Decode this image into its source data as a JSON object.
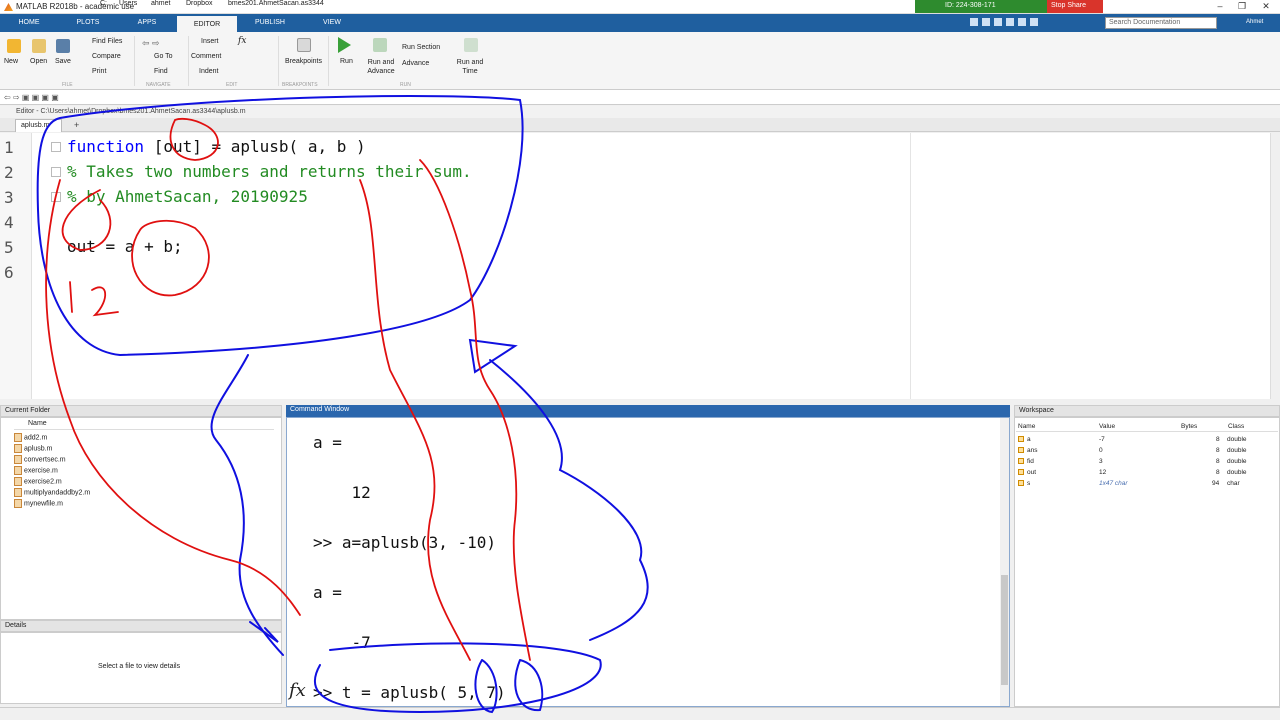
{
  "window": {
    "title": "MATLAB R2018b - academic use"
  },
  "share": {
    "id": "ID: 224-308-171",
    "stop": "Stop Share"
  },
  "tabs": [
    "HOME",
    "PLOTS",
    "APPS",
    "EDITOR",
    "PUBLISH",
    "VIEW"
  ],
  "search": {
    "placeholder": "Search Documentation"
  },
  "user": "Ahmet",
  "ribbon": {
    "file": {
      "new": "New",
      "open": "Open",
      "save": "Save",
      "find_files": "Find Files",
      "compare": "Compare",
      "print": "Print",
      "section": "FILE"
    },
    "navigate": {
      "go_to": "Go To",
      "find": "Find",
      "section": "NAVIGATE"
    },
    "edit": {
      "insert": "Insert",
      "comment": "Comment",
      "indent": "Indent",
      "section": "EDIT"
    },
    "breakpoints": {
      "label": "Breakpoints",
      "section": "BREAKPOINTS"
    },
    "run": {
      "run": "Run",
      "run_advance": "Run and Advance",
      "run_section": "Run Section",
      "advance": "Advance",
      "run_time": "Run and Time",
      "section": "RUN"
    }
  },
  "path": [
    "C:",
    "Users",
    "ahmet",
    "Dropbox",
    "bmes201.AhmetSacan.as3344"
  ],
  "editor": {
    "header": "Editor - C:\\Users\\ahmet\\Dropbox\\bmes201.AhmetSacan.as3344\\aplusb.m",
    "tab": "aplusb.m",
    "lines": [
      {
        "n": "1",
        "kw": "function",
        "rest": " [out] = aplusb( a, b )"
      },
      {
        "n": "2",
        "comment": "% Takes two numbers and returns their sum."
      },
      {
        "n": "3",
        "comment": "% by AhmetSacan, 20190925"
      },
      {
        "n": "4",
        "text": ""
      },
      {
        "n": "5",
        "text": "out = a + b;"
      },
      {
        "n": "6",
        "text": ""
      }
    ]
  },
  "current_folder": {
    "title": "Current Folder",
    "col": "Name",
    "files": [
      "add2.m",
      "aplusb.m",
      "convertsec.m",
      "exercise.m",
      "exercise2.m",
      "multiplyandaddby2.m",
      "mynewfile.m"
    ]
  },
  "details": {
    "title": "Details",
    "msg": "Select a file to view details"
  },
  "command_window": {
    "title": "Command Window",
    "lines": [
      "a =",
      "    12",
      ">> a=aplusb(3, -10)",
      "a =",
      "    -7",
      ">> t = aplusb( 5, 7)"
    ],
    "fx": "fx"
  },
  "workspace": {
    "title": "Workspace",
    "cols": [
      "Name",
      "Value",
      "Bytes",
      "Class"
    ],
    "rows": [
      {
        "name": "a",
        "value": "-7",
        "bytes": "8",
        "class": "double"
      },
      {
        "name": "ans",
        "value": "0",
        "bytes": "8",
        "class": "double"
      },
      {
        "name": "fid",
        "value": "3",
        "bytes": "8",
        "class": "double"
      },
      {
        "name": "out",
        "value": "12",
        "bytes": "8",
        "class": "double"
      },
      {
        "name": "s",
        "value": "1x47 char",
        "bytes": "94",
        "class": "char"
      }
    ]
  },
  "colors": {
    "ribbon_blue": "#1f5f9f",
    "keyword": "#0000ff",
    "comment": "#228b22",
    "ink_blue": "#1010e0",
    "ink_red": "#e01010"
  }
}
